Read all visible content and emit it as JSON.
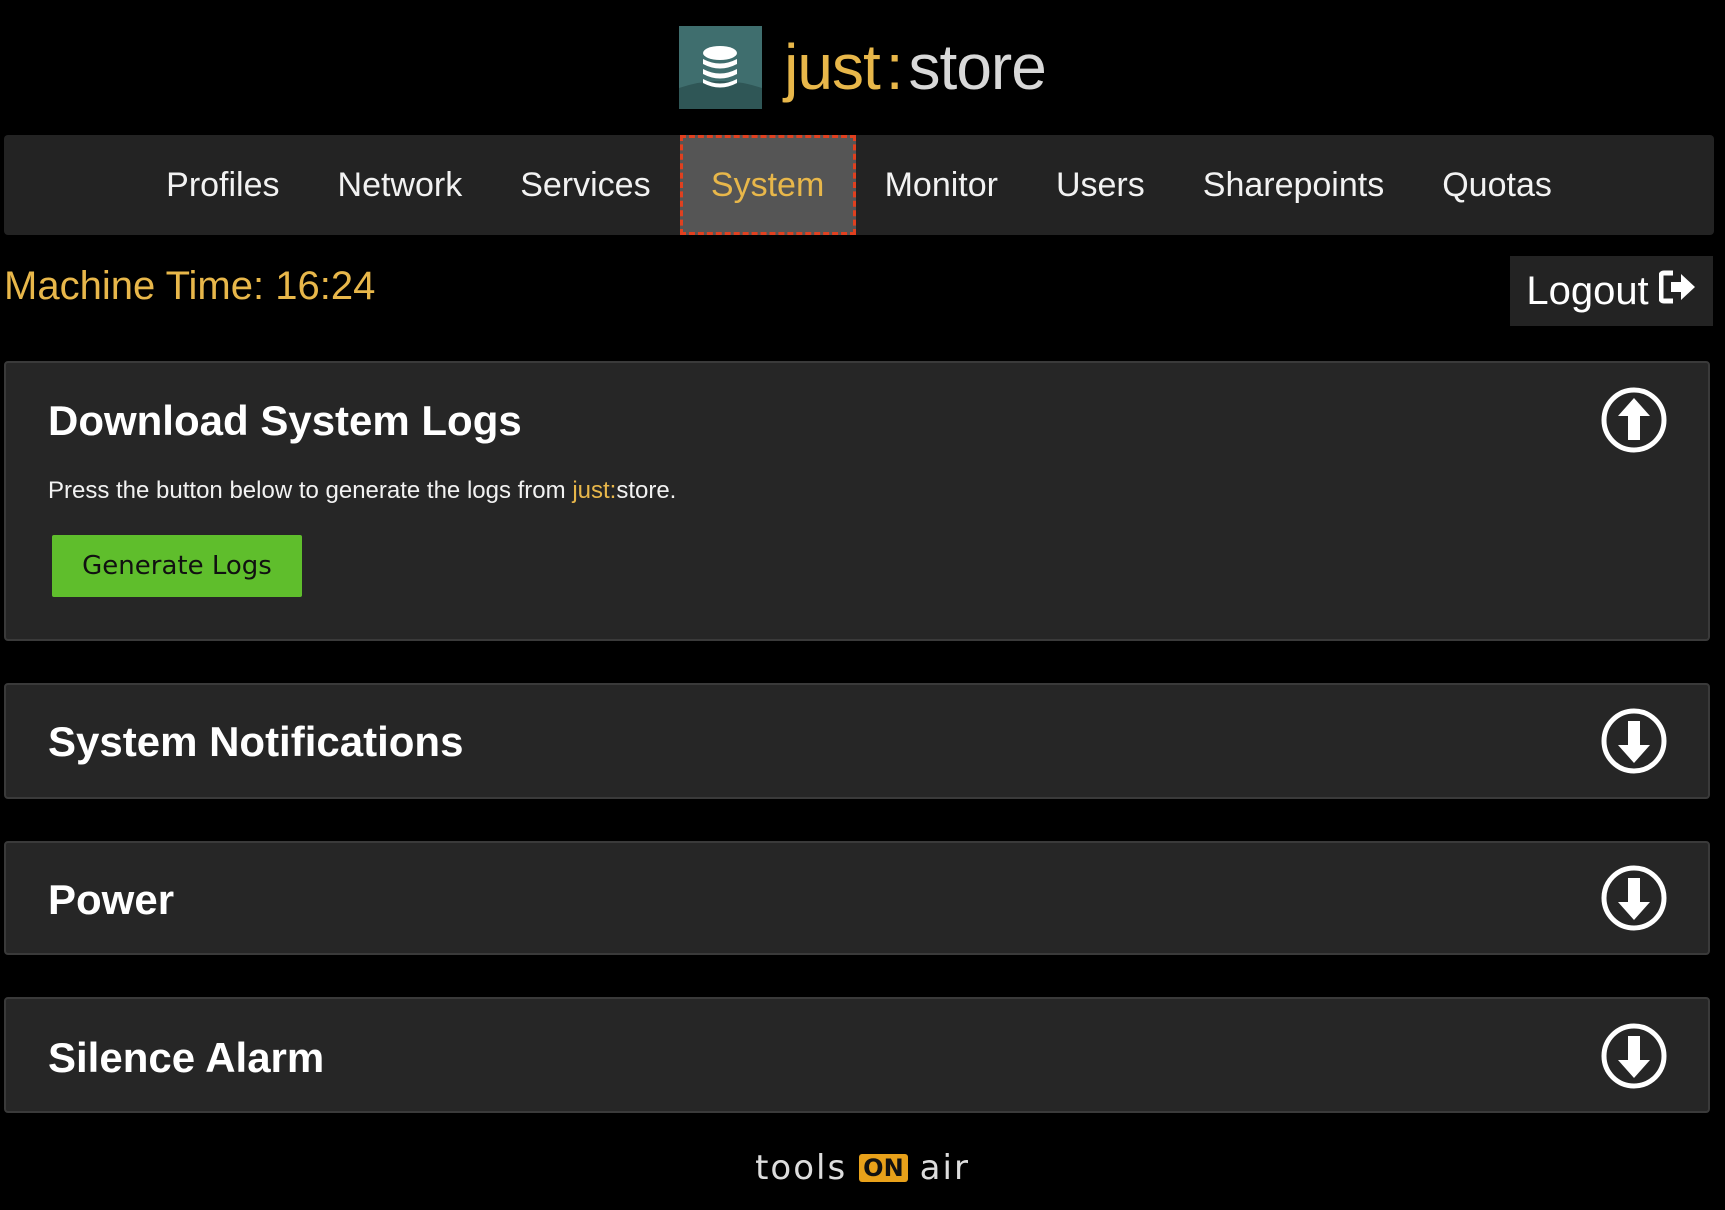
{
  "brand": {
    "name_part1": "just",
    "separator": ":",
    "name_part2": "store",
    "icon": "database-stack-icon"
  },
  "nav": {
    "items": [
      {
        "label": "Profiles",
        "active": false
      },
      {
        "label": "Network",
        "active": false
      },
      {
        "label": "Services",
        "active": false
      },
      {
        "label": "System",
        "active": true
      },
      {
        "label": "Monitor",
        "active": false
      },
      {
        "label": "Users",
        "active": false
      },
      {
        "label": "Sharepoints",
        "active": false
      },
      {
        "label": "Quotas",
        "active": false
      }
    ]
  },
  "status": {
    "machine_time": "Machine Time: 16:24"
  },
  "logout": {
    "label": "Logout",
    "icon": "sign-out-icon"
  },
  "panels": {
    "logs": {
      "title": "Download System Logs",
      "desc_before": "Press the button below to generate the logs from ",
      "desc_brand": "just:",
      "desc_after": "store.",
      "button": "Generate Logs",
      "toggle_icon": "circle-arrow-up-icon"
    },
    "notifications": {
      "title": "System Notifications",
      "toggle_icon": "circle-arrow-down-icon"
    },
    "power": {
      "title": "Power",
      "toggle_icon": "circle-arrow-down-icon"
    },
    "silence": {
      "title": "Silence Alarm",
      "toggle_icon": "circle-arrow-down-icon"
    }
  },
  "footer": {
    "part1": "tools",
    "part2": "ON",
    "part3": "air"
  },
  "colors": {
    "accent": "#e8b74a",
    "panel_bg": "#262626",
    "button_green": "#5fbe2c",
    "active_outline": "#e0401f"
  }
}
